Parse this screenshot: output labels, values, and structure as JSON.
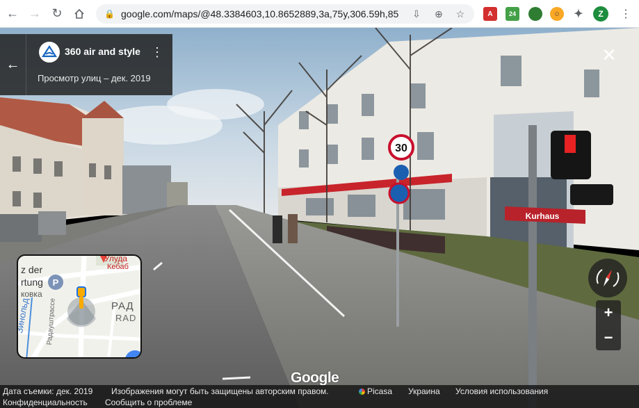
{
  "browser": {
    "url": "google.com/maps/@48.3384603,10.8652889,3a,75y,306.59h,85....",
    "profile_initial": "Z",
    "ext_counter": "24"
  },
  "header": {
    "place_title": "360 air and style",
    "capture_date": "Просмотр улиц – дек. 2019"
  },
  "scene": {
    "speed_limit": "30",
    "street_sign": "Kurhaus"
  },
  "minimap": {
    "labels": [
      "z der",
      "rtung",
      "ковка",
      "Улуда",
      "Кебаб",
      "РАД",
      "RAD",
      "Зинольд",
      "Радауштрассе"
    ],
    "parking_symbol": "P"
  },
  "controls": {
    "zoom_in": "+",
    "zoom_out": "−"
  },
  "logo": "Google",
  "footer": {
    "capture_date": "Дата съемки: дек. 2019",
    "copyright": "Изображения могут быть защищены авторским правом.",
    "picasa": "Picasa",
    "country": "Украина",
    "terms": "Условия использования",
    "privacy": "Конфиденциальность",
    "report": "Сообщить о проблеме"
  },
  "colors": {
    "header_bg": "#222222",
    "sky": "#aec6da",
    "road": "#6b6b6b",
    "sign_red": "#c8102e",
    "map_blue": "#4285f4"
  }
}
